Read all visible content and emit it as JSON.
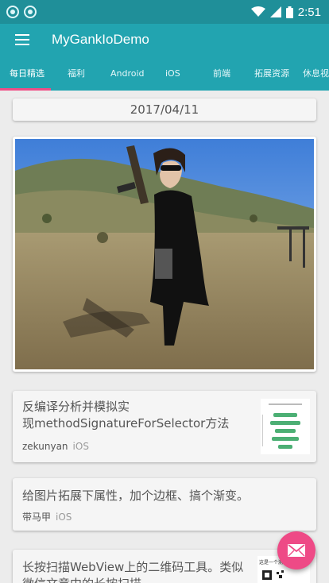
{
  "status_bar": {
    "time": "2:51",
    "notification_icons": [
      "sync-icon",
      "sync-icon"
    ]
  },
  "app_bar": {
    "title": "MyGankIoDemo",
    "menu_icon": "hamburger-menu-icon"
  },
  "tabs": [
    {
      "label": "每日精选",
      "active": true
    },
    {
      "label": "福利"
    },
    {
      "label": "Android"
    },
    {
      "label": "iOS"
    },
    {
      "label": "前端"
    },
    {
      "label": "拓展资源"
    },
    {
      "label": "休息视"
    }
  ],
  "date_header": "2017/04/11",
  "articles": [
    {
      "title_line1": "反编译分析并模拟实",
      "title_line2": "现methodSignatureForSelector方法",
      "author": "zekunyan",
      "tag": "iOS"
    },
    {
      "title_line1": "给图片拓展下属性，加个边框、搞个渐变。",
      "author": "带马甲",
      "tag": "iOS"
    },
    {
      "title_line1": "长按扫描WebView上的二维码工具。类似",
      "title_line2": "微信文章中的长按扫描",
      "thumb_caption": "这是一个测试的二维码"
    }
  ],
  "fab": {
    "icon": "mail-icon"
  },
  "colors": {
    "primary": "#22a4b0",
    "status_bar": "#1f8f99",
    "accent": "#ee4a86",
    "indicator": "#ef4d86"
  }
}
